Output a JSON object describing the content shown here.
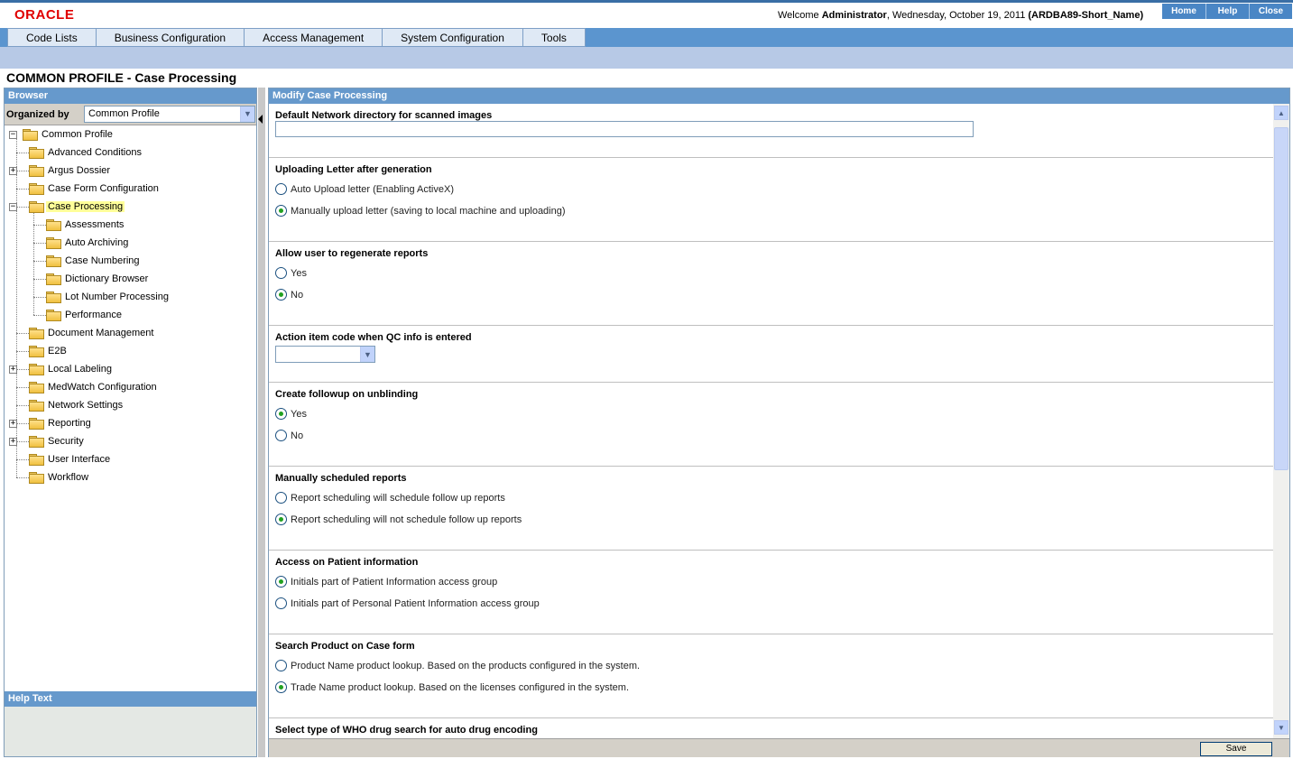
{
  "header": {
    "logo": "ORACLE",
    "welcome_prefix": "Welcome ",
    "user": "Administrator",
    "welcome_date": ", Wednesday, October 19, 2011 ",
    "database": "(ARDBA89-Short_Name)",
    "links": [
      "Home",
      "Help",
      "Close"
    ]
  },
  "menu": [
    "Code Lists",
    "Business Configuration",
    "Access Management",
    "System Configuration",
    "Tools"
  ],
  "page_title": "COMMON PROFILE - Case Processing",
  "browser": {
    "title": "Browser",
    "organized_by_label": "Organized by",
    "organized_by_value": "Common Profile",
    "tree": [
      {
        "label": "Common Profile",
        "level": 0,
        "expander": "-",
        "open": true
      },
      {
        "label": "Advanced Conditions",
        "level": 1,
        "expander": ""
      },
      {
        "label": "Argus Dossier",
        "level": 1,
        "expander": "+"
      },
      {
        "label": "Case Form Configuration",
        "level": 1,
        "expander": ""
      },
      {
        "label": "Case Processing",
        "level": 1,
        "expander": "-",
        "open": true,
        "selected": true
      },
      {
        "label": "Assessments",
        "level": 2,
        "expander": ""
      },
      {
        "label": "Auto Archiving",
        "level": 2,
        "expander": ""
      },
      {
        "label": "Case Numbering",
        "level": 2,
        "expander": ""
      },
      {
        "label": "Dictionary Browser",
        "level": 2,
        "expander": ""
      },
      {
        "label": "Lot Number Processing",
        "level": 2,
        "expander": ""
      },
      {
        "label": "Performance",
        "level": 2,
        "expander": ""
      },
      {
        "label": "Document Management",
        "level": 1,
        "expander": ""
      },
      {
        "label": "E2B",
        "level": 1,
        "expander": ""
      },
      {
        "label": "Local Labeling",
        "level": 1,
        "expander": "+"
      },
      {
        "label": "MedWatch Configuration",
        "level": 1,
        "expander": ""
      },
      {
        "label": "Network Settings",
        "level": 1,
        "expander": ""
      },
      {
        "label": "Reporting",
        "level": 1,
        "expander": "+"
      },
      {
        "label": "Security",
        "level": 1,
        "expander": "+"
      },
      {
        "label": "User Interface",
        "level": 1,
        "expander": ""
      },
      {
        "label": "Workflow",
        "level": 1,
        "expander": ""
      }
    ]
  },
  "help": {
    "title": "Help Text"
  },
  "modify": {
    "title": "Modify Case Processing",
    "save_label": "Save",
    "sections": [
      {
        "title": "Default Network directory for scanned images",
        "type": "text",
        "value": ""
      },
      {
        "title": "Uploading Letter after generation",
        "type": "radio",
        "options": [
          {
            "label": "Auto Upload letter (Enabling ActiveX)",
            "checked": false
          },
          {
            "label": "Manually upload letter (saving to local machine and uploading)",
            "checked": true
          }
        ]
      },
      {
        "title": "Allow user to regenerate reports",
        "type": "radio",
        "options": [
          {
            "label": "Yes",
            "checked": false
          },
          {
            "label": "No",
            "checked": true
          }
        ]
      },
      {
        "title": "Action item code when QC info is entered",
        "type": "select",
        "value": ""
      },
      {
        "title": "Create followup on unblinding",
        "type": "radio",
        "options": [
          {
            "label": "Yes",
            "checked": true
          },
          {
            "label": "No",
            "checked": false
          }
        ]
      },
      {
        "title": "Manually scheduled reports",
        "type": "radio",
        "options": [
          {
            "label": "Report scheduling will schedule follow up reports",
            "checked": false
          },
          {
            "label": "Report scheduling will not schedule follow up reports",
            "checked": true
          }
        ]
      },
      {
        "title": "Access on Patient information",
        "type": "radio",
        "options": [
          {
            "label": "Initials part of Patient Information access group",
            "checked": true
          },
          {
            "label": "Initials part of Personal Patient Information access group",
            "checked": false
          }
        ]
      },
      {
        "title": "Search Product on Case form",
        "type": "radio",
        "options": [
          {
            "label": "Product Name product lookup. Based on the products configured in the system.",
            "checked": false
          },
          {
            "label": "Trade Name product lookup. Based on the licenses configured in the system.",
            "checked": true
          }
        ]
      },
      {
        "title": "Select type of WHO drug search for auto drug encoding",
        "type": "radio",
        "options": []
      }
    ]
  }
}
